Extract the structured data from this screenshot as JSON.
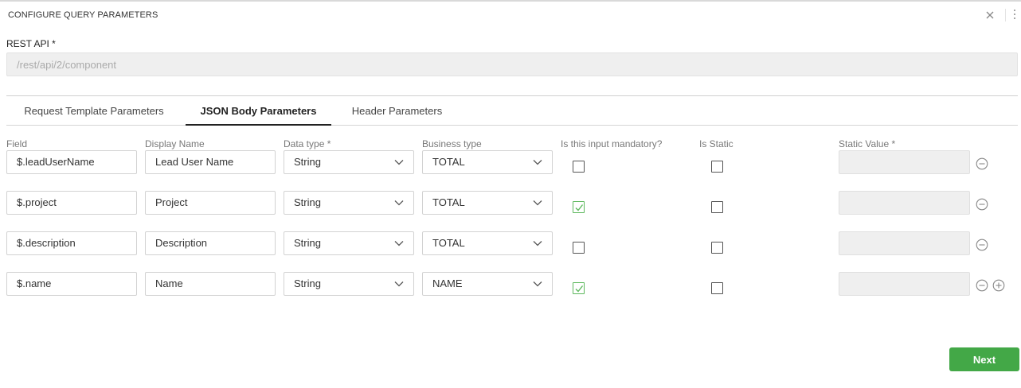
{
  "dialog": {
    "title": "CONFIGURE QUERY PARAMETERS"
  },
  "rest_api": {
    "label": "REST API *",
    "value": "/rest/api/2/component"
  },
  "tabs": [
    {
      "label": "Request Template Parameters",
      "active": false
    },
    {
      "label": "JSON Body Parameters",
      "active": true
    },
    {
      "label": "Header Parameters",
      "active": false
    }
  ],
  "columns": {
    "field": "Field",
    "display_name": "Display Name",
    "data_type": "Data type *",
    "business_type": "Business type",
    "mandatory": "Is this input mandatory?",
    "is_static": "Is Static",
    "static_value": "Static Value *"
  },
  "rows": [
    {
      "field": "$.leadUserName",
      "display_name": "Lead User Name",
      "data_type": "String",
      "business_type": "TOTAL",
      "mandatory": false,
      "is_static": false,
      "static_value": ""
    },
    {
      "field": "$.project",
      "display_name": "Project",
      "data_type": "String",
      "business_type": "TOTAL",
      "mandatory": true,
      "is_static": false,
      "static_value": ""
    },
    {
      "field": "$.description",
      "display_name": "Description",
      "data_type": "String",
      "business_type": "TOTAL",
      "mandatory": false,
      "is_static": false,
      "static_value": ""
    },
    {
      "field": "$.name",
      "display_name": "Name",
      "data_type": "String",
      "business_type": "NAME",
      "mandatory": true,
      "is_static": false,
      "static_value": ""
    }
  ],
  "colors": {
    "accent_green": "#43a847",
    "check_green": "#5cb85c"
  },
  "icons": {
    "close": "close-icon",
    "more": "more-vertical-icon",
    "remove": "minus-circle-icon",
    "add": "plus-circle-icon",
    "chevron": "chevron-down-icon"
  },
  "footer": {
    "next_label": "Next"
  }
}
